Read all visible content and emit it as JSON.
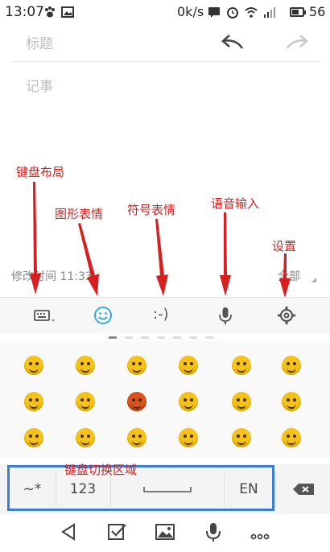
{
  "status_bar": {
    "time": "13:07",
    "net_speed": "0k/s",
    "battery_percent": "56",
    "battery_level": 0.56,
    "icons": [
      "paw-icon",
      "image-icon",
      "message-icon",
      "alarm-icon",
      "wifi-icon",
      "signal-icon",
      "battery-icon"
    ]
  },
  "note": {
    "title_placeholder": "标题",
    "body_placeholder": "记事",
    "modified_label": "修改时间 11:33",
    "all_label": "全部"
  },
  "annotations": {
    "keyboard_layout": "键盘布局",
    "graphic_emoji": "图形表情",
    "symbol_emoji": "符号表情",
    "voice_input": "语音输入",
    "settings": "设置",
    "keyboard_switch_area": "键盘切换区域"
  },
  "toolbar": {
    "symbol_emoticon": ":-)",
    "icons": [
      "keyboard-icon",
      "smiley-icon",
      "symbol-emoticon",
      "microphone-icon",
      "gear-icon",
      "undo-icon",
      "redo-icon"
    ]
  },
  "keyboard_row": {
    "symbols": "~*",
    "numbers": "123",
    "language": "EN"
  },
  "nav_bar": {
    "icons": [
      "back-icon",
      "checkbox-icon",
      "image-icon",
      "microphone-icon",
      "more-icon"
    ]
  },
  "colors": {
    "annotation_red": "#d42020",
    "highlight_blue": "#3a7fcf",
    "emoji_yellow": "#f5c21a",
    "active_blue": "#3aa8e0"
  }
}
